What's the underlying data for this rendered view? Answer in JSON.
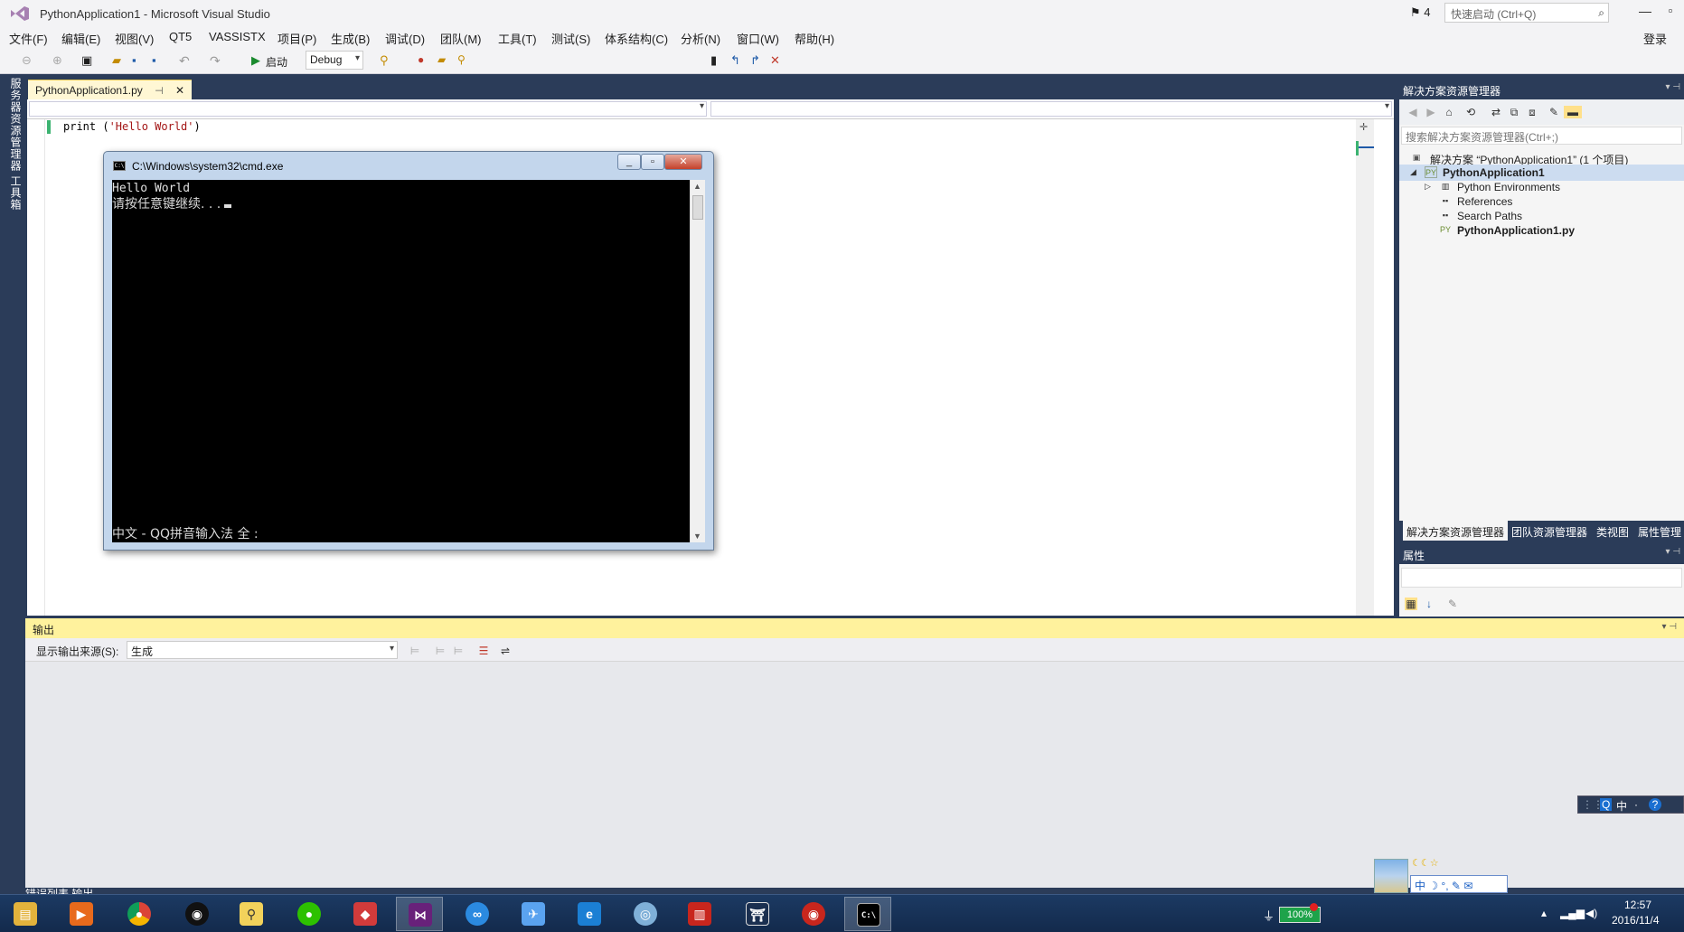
{
  "window": {
    "title": "PythonApplication1 - Microsoft Visual Studio",
    "notification_count": "4",
    "quick_launch_placeholder": "快速启动 (Ctrl+Q)",
    "login": "登录"
  },
  "menu": [
    "文件(F)",
    "编辑(E)",
    "视图(V)",
    "QT5",
    "VASSISTX",
    "项目(P)",
    "生成(B)",
    "调试(D)",
    "团队(M)",
    "工具(T)",
    "测试(S)",
    "体系结构(C)",
    "分析(N)",
    "窗口(W)",
    "帮助(H)"
  ],
  "toolbar": {
    "start_label": "启动",
    "configuration": "Debug"
  },
  "left_rail": {
    "server_explorer": "服务器资源管理器",
    "toolbox": "工具箱"
  },
  "editor": {
    "tab_label": "PythonApplication1.py",
    "code_keyword": "print",
    "code_open": " (",
    "code_string": "'Hello World'",
    "code_close": ")"
  },
  "cmd": {
    "title": "C:\\Windows\\system32\\cmd.exe",
    "line1": "Hello World",
    "line2": "请按任意键继续. . .",
    "ime_status": "中文 - QQ拼音输入法 全 :",
    "icon_text": "C:\\"
  },
  "solution_explorer": {
    "header": "解决方案资源管理器",
    "search_placeholder": "搜索解决方案资源管理器(Ctrl+;)",
    "tree": {
      "solution": "解决方案 “PythonApplication1” (1 个项目)",
      "project": "PythonApplication1",
      "environments": "Python Environments",
      "references": "References",
      "search_paths": "Search Paths",
      "file": "PythonApplication1.py"
    },
    "bottom_tabs": [
      "解决方案资源管理器",
      "团队资源管理器",
      "类视图",
      "属性管理"
    ]
  },
  "properties": {
    "header": "属性"
  },
  "output": {
    "header": "输出",
    "source_label": "显示输出来源(S):",
    "source_value": "生成",
    "bottom_tabs": "错误列表  输出"
  },
  "ime": {
    "bar": [
      "Q",
      "中",
      "·",
      "?"
    ],
    "widget_moons": "☾☾☆",
    "widget_row": "中 ☽ °, ✎ ✉"
  },
  "taskbar": {
    "apps": [
      "file-explorer",
      "media-player",
      "chrome",
      "qq",
      "search-app",
      "wechat",
      "tool-app",
      "visual-studio",
      "baidu-netdisk",
      "feishu-app",
      "browser-app",
      "cloud-app",
      "red-app",
      "gate-app",
      "red-icon-app",
      "cmd"
    ],
    "battery": "100%",
    "time": "12:57",
    "date": "2016/11/4"
  },
  "colors": {
    "chrome_bg": "#2b3c59",
    "output_header": "#fff29d",
    "tab_active": "#fff7d4"
  }
}
